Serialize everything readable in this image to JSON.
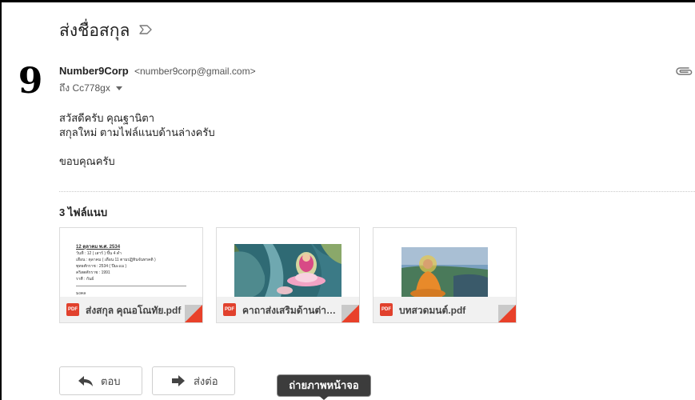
{
  "email": {
    "subject": "ส่งชื่อสกุล",
    "sender": {
      "name": "Number9Corp",
      "email": "<number9corp@gmail.com>",
      "avatar_text": "9"
    },
    "recipient": "ถึง Cc778gx",
    "body_lines": [
      "สวัสดีครับ คุณฐานิตา",
      "สกุลใหม่ ตามไฟล์แนบด้านล่างครับ",
      "ขอบคุณครับ"
    ]
  },
  "attachments": {
    "count_label": "3 ไฟล์แนบ",
    "badge_label": "PDF",
    "items": [
      {
        "filename": "ส่งสกุล คุณอโณทัย.pdf",
        "preview": {
          "heading": "12 ตุลาคม พ.ศ. 2534",
          "lines": [
            "วันที่ : 12 ( เสาร์ ) ขึ้น 4 ค่ำ",
            "เดือน : ตุลาคม ( เดือน 11 ตามปฏิทินจันทรคติ )",
            "พุทธศักราช : 2534 ( ปีมะแม )",
            "คริสตศักราช : 1991",
            "ราศี : กันย์"
          ],
          "footer": "มงคล"
        }
      },
      {
        "filename": "คาถาส่งเสริมด้านต่างๆ.pdf"
      },
      {
        "filename": "บทสวดมนต์.pdf"
      }
    ]
  },
  "actions": {
    "reply_label": "ตอบ",
    "forward_label": "ส่งต่อ"
  },
  "tooltip": "ถ่ายภาพหน้าจอ",
  "colors": {
    "pdf_red": "#e1412d",
    "corner_red": "#e8412a",
    "tooltip_bg": "#3c3c3c"
  }
}
